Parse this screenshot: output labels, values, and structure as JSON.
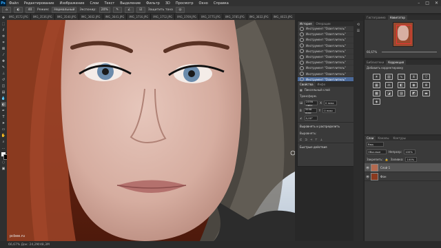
{
  "app": {
    "logo": "Ps"
  },
  "menu": [
    "Файл",
    "Редактирование",
    "Изображение",
    "Слои",
    "Текст",
    "Выделение",
    "Фильтр",
    "3D",
    "Просмотр",
    "Окно",
    "Справка"
  ],
  "window_controls": [
    "–",
    "□",
    "✕"
  ],
  "options": {
    "tool_icon": "spot-healing-icon",
    "brush_size": "40",
    "mode_label": "Режим:",
    "mode_value": "Нормальный",
    "exposure_label": "Экспонир:",
    "exposure_value": "20%",
    "protect_tones": "Защитить тона"
  },
  "tabs": [
    "IMG_0572.JPG",
    "IMG_3536.JPG",
    "IMG_3540.JPG",
    "IMG_3602.JPG",
    "IMG_3641.JPG",
    "IMG_3716.JPG",
    "IMG_3752.JPG",
    "IMG_3769.JPG",
    "IMG_3775.JPG",
    "IMG_3785.JPG",
    "IMG_3832.JPG",
    "IMG_4023.JPG",
    "IMG_0721.JPG @ 66,7% (Слой 1, RGB/8)"
  ],
  "active_tab_index": 12,
  "history": {
    "tabs": [
      "История",
      "Операции"
    ],
    "active_tab": 0,
    "items": [
      "Инструмент \"Осветлитель\"",
      "Инструмент \"Осветлитель\"",
      "Инструмент \"Осветлитель\"",
      "Инструмент \"Осветлитель\"",
      "Инструмент \"Осветлитель\"",
      "Инструмент \"Осветлитель\"",
      "Инструмент \"Осветлитель\"",
      "Инструмент \"Осветлитель\"",
      "Инструмент \"Осветлитель\"",
      "Инструмент \"Осветлитель\""
    ],
    "selected_index": 9
  },
  "properties": {
    "tabs": [
      "Свойства",
      "Инфо"
    ],
    "title": "Пиксельный слой",
    "transform_label": "Трансформ.",
    "w": "2376 пикс",
    "h": "3558 пикс",
    "x": "0 пикс",
    "y": "0 пикс",
    "angle": "0,00°",
    "align_label": "Выровнять и распределить",
    "align_sub": "Выровнять:",
    "quick_actions": "Быстрые действия"
  },
  "navigator": {
    "tabs": [
      "Гистограмма",
      "Навигатор"
    ],
    "zoom": "66,67%"
  },
  "adjustments": {
    "tabs": [
      "Библиотеки",
      "Коррекция"
    ],
    "hint": "Добавить корректировку",
    "icons": [
      "brightness-icon",
      "levels-icon",
      "curves-icon",
      "exposure-icon",
      "vibrance-icon",
      "hue-icon",
      "color-balance-icon",
      "bw-icon",
      "photo-filter-icon",
      "channel-mixer-icon",
      "color-lookup-icon",
      "invert-icon",
      "posterize-icon",
      "threshold-icon",
      "gradient-map-icon",
      "selective-color-icon"
    ]
  },
  "layers": {
    "tabs": [
      "Слои",
      "Каналы",
      "Контуры"
    ],
    "kind_label": "Вид",
    "blend": "Обычные",
    "opacity_label": "Непрозр:",
    "opacity": "100%",
    "lock_label": "Закрепить:",
    "fill_label": "Заливка:",
    "fill": "100%",
    "items": [
      "Слой 1",
      "Фон"
    ],
    "selected_index": 0
  },
  "status": {
    "text": "66,67%   Док: 24,2M/48,3M"
  },
  "watermark": "pcbee.ru",
  "colors": {
    "accent": "#4b6a9a",
    "hair": "#8a3a1f",
    "skin": "#d9b3a6"
  }
}
